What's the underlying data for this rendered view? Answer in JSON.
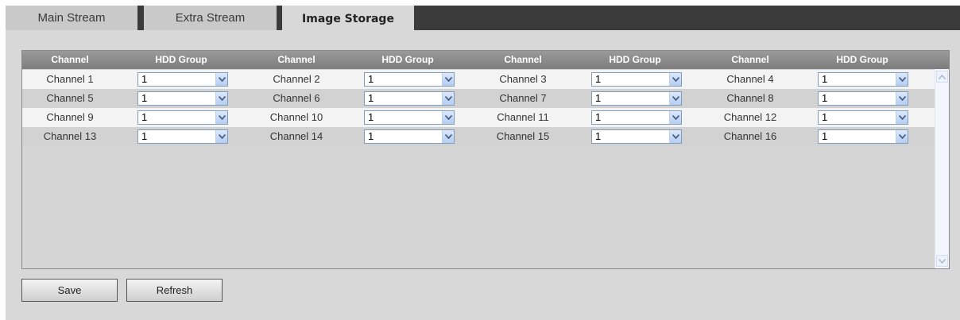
{
  "tabs": [
    {
      "label": "Main Stream",
      "active": false
    },
    {
      "label": "Extra Stream",
      "active": false
    },
    {
      "label": "Image Storage",
      "active": true
    }
  ],
  "table": {
    "headers": [
      "Channel",
      "HDD Group",
      "Channel",
      "HDD Group",
      "Channel",
      "HDD Group",
      "Channel",
      "HDD Group"
    ],
    "rows": [
      [
        {
          "channel": "Channel 1",
          "hdd": "1"
        },
        {
          "channel": "Channel 2",
          "hdd": "1"
        },
        {
          "channel": "Channel 3",
          "hdd": "1"
        },
        {
          "channel": "Channel 4",
          "hdd": "1"
        }
      ],
      [
        {
          "channel": "Channel 5",
          "hdd": "1"
        },
        {
          "channel": "Channel 6",
          "hdd": "1"
        },
        {
          "channel": "Channel 7",
          "hdd": "1"
        },
        {
          "channel": "Channel 8",
          "hdd": "1"
        }
      ],
      [
        {
          "channel": "Channel 9",
          "hdd": "1"
        },
        {
          "channel": "Channel 10",
          "hdd": "1"
        },
        {
          "channel": "Channel 11",
          "hdd": "1"
        },
        {
          "channel": "Channel 12",
          "hdd": "1"
        }
      ],
      [
        {
          "channel": "Channel 13",
          "hdd": "1"
        },
        {
          "channel": "Channel 14",
          "hdd": "1"
        },
        {
          "channel": "Channel 15",
          "hdd": "1"
        },
        {
          "channel": "Channel 16",
          "hdd": "1"
        }
      ]
    ]
  },
  "buttons": {
    "save": "Save",
    "refresh": "Refresh"
  },
  "icons": {
    "dropdown": "chevron-down-icon",
    "scroll_up": "arrow-up-icon",
    "scroll_down": "arrow-down-icon"
  },
  "colors": {
    "tab_bar": "#3b3b3b",
    "panel": "#d8d8d8",
    "header": "#8a8a8a",
    "arrow": "#4d6185"
  }
}
